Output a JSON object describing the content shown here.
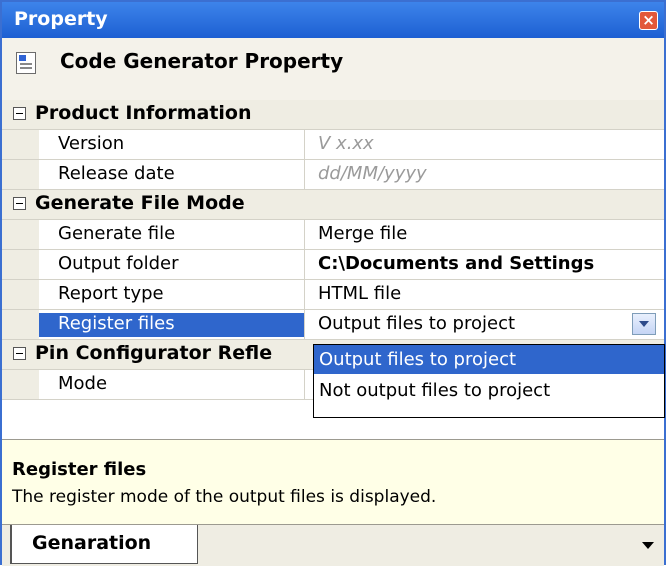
{
  "window": {
    "title": "Property"
  },
  "header": {
    "label": "Code Generator Property"
  },
  "sections": [
    {
      "label": "Product Information"
    },
    {
      "label": "Generate File Mode"
    },
    {
      "label": "Pin Configurator Refle"
    }
  ],
  "rows": {
    "version": {
      "key": "Version",
      "value": "V x.xx"
    },
    "release_date": {
      "key": "Release date",
      "value": "dd/MM/yyyy"
    },
    "generate_file": {
      "key": "Generate file",
      "value": "Merge file"
    },
    "output_folder": {
      "key": "Output folder",
      "value": "C:\\Documents and Settings"
    },
    "report_type": {
      "key": "Report type",
      "value": "HTML file"
    },
    "register_files": {
      "key": "Register files",
      "value": "Output files to project"
    },
    "mode": {
      "key": "Mode",
      "value": ""
    }
  },
  "dropdown": {
    "options": [
      "Output files to project",
      "Not output files to project"
    ],
    "selected": "Output files to project"
  },
  "description": {
    "title": "Register files",
    "text": "The register mode of the output files is displayed."
  },
  "tabs": [
    {
      "label": "Genaration"
    }
  ]
}
